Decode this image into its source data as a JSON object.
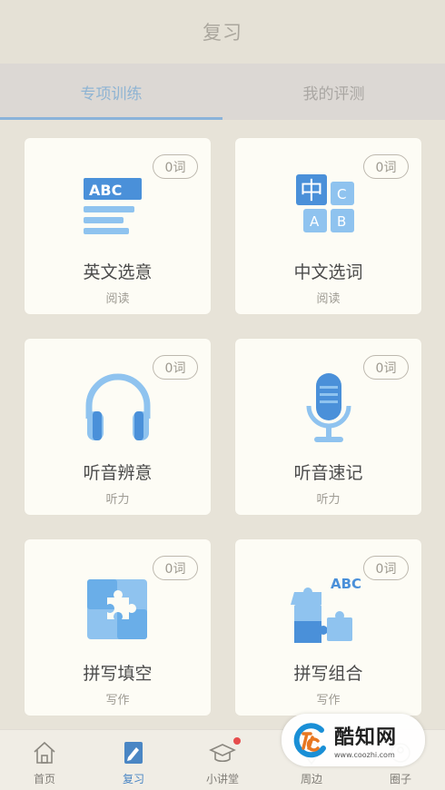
{
  "header": {
    "title": "复习"
  },
  "tabs": [
    {
      "label": "专项训练",
      "active": true
    },
    {
      "label": "我的评测",
      "active": false
    }
  ],
  "cards": [
    {
      "title": "英文选意",
      "subtitle": "阅读",
      "badge": "0词",
      "icon": "abc-list-icon"
    },
    {
      "title": "中文选词",
      "subtitle": "阅读",
      "badge": "0词",
      "icon": "chinese-abc-tiles-icon"
    },
    {
      "title": "听音辨意",
      "subtitle": "听力",
      "badge": "0词",
      "icon": "headphones-icon"
    },
    {
      "title": "听音速记",
      "subtitle": "听力",
      "badge": "0词",
      "icon": "microphone-icon"
    },
    {
      "title": "拼写填空",
      "subtitle": "写作",
      "badge": "0词",
      "icon": "puzzle-square-icon"
    },
    {
      "title": "拼写组合",
      "subtitle": "写作",
      "badge": "0词",
      "icon": "puzzle-abc-icon"
    }
  ],
  "bottom_nav": [
    {
      "label": "首页",
      "icon": "home-icon",
      "active": false
    },
    {
      "label": "复习",
      "icon": "notebook-pen-icon",
      "active": true
    },
    {
      "label": "小讲堂",
      "icon": "graduation-cap-icon",
      "active": false,
      "notification_dot": true
    },
    {
      "label": "周边",
      "icon": "location-icon",
      "active": false
    },
    {
      "label": "圈子",
      "icon": "circle-group-icon",
      "active": false
    }
  ],
  "watermark": {
    "name": "酷知网",
    "url": "www.coozhi.com"
  },
  "colors": {
    "background": "#e7e3d8",
    "card": "#fdfcf5",
    "accent_blue": "#4a90d9",
    "light_blue": "#8fc3ef",
    "active_tab": "#8fb4d3"
  }
}
